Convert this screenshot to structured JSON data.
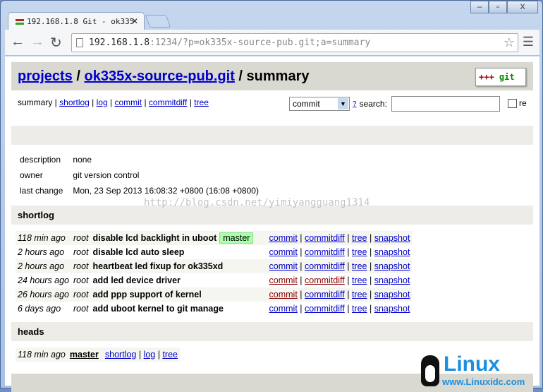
{
  "browser": {
    "tab_title": "192.168.1.8 Git - ok335",
    "url_host": "192.168.1.8",
    "url_rest": ":1234/?p=ok335x-source-pub.git;a=summary"
  },
  "header": {
    "projects": "projects",
    "sep1": " / ",
    "repo": "ok335x-source-pub.git",
    "sep2": " / summary",
    "logo_plus": "+++",
    "logo_text": " git"
  },
  "nav": {
    "current": "summary",
    "links": [
      "shortlog",
      "log",
      "commit",
      "commitdiff",
      "tree"
    ]
  },
  "search": {
    "type": "commit",
    "help": "?",
    "label": "search:",
    "value": "",
    "re_label": "re"
  },
  "project": [
    {
      "key": "description",
      "value": "none"
    },
    {
      "key": "owner",
      "value": "git version control"
    },
    {
      "key": "last change",
      "value": "Mon, 23 Sep 2013 16:08:32 +0800 (16:08 +0800)"
    }
  ],
  "shortlog": {
    "title": "shortlog",
    "rows": [
      {
        "age": "118 min ago",
        "author": "root",
        "subject": "disable lcd backlight in uboot",
        "ref": "master",
        "visited": []
      },
      {
        "age": "2 hours ago",
        "author": "root",
        "subject": "disable lcd auto sleep",
        "ref": "",
        "visited": []
      },
      {
        "age": "2 hours ago",
        "author": "root",
        "subject": "heartbeat led fixup for ok335xd",
        "ref": "",
        "visited": []
      },
      {
        "age": "24 hours ago",
        "author": "root",
        "subject": "add led device driver",
        "ref": "",
        "visited": [
          "commit",
          "commitdiff"
        ]
      },
      {
        "age": "26 hours ago",
        "author": "root",
        "subject": "add ppp support of kernel",
        "ref": "",
        "visited": [
          "commit"
        ]
      },
      {
        "age": "6 days ago",
        "author": "root",
        "subject": "add uboot kernel to git manage",
        "ref": "",
        "visited": []
      }
    ],
    "links": [
      "commit",
      "commitdiff",
      "tree",
      "snapshot"
    ]
  },
  "heads": {
    "title": "heads",
    "rows": [
      {
        "age": "118 min ago",
        "name": "master",
        "links": [
          "shortlog",
          "log",
          "tree"
        ]
      }
    ]
  },
  "watermark": "http://blog.csdn.net/yimiyangguang1314",
  "logo_watermark": {
    "text": "Linux",
    "url": "www.Linuxidc.com"
  }
}
